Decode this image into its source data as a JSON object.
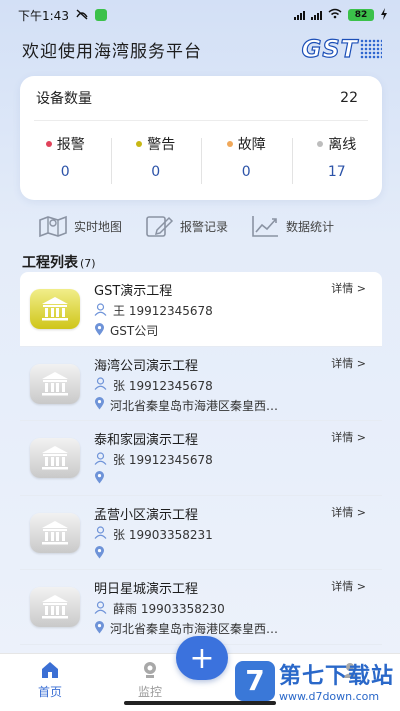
{
  "status_bar": {
    "time": "下午1:43",
    "right_text": "82"
  },
  "header": {
    "title": "欢迎使用海湾服务平台",
    "logo": "GST"
  },
  "device_card": {
    "label": "设备数量",
    "count": "22",
    "stats": [
      {
        "label": "报警",
        "value": "0",
        "color": "#e0425a"
      },
      {
        "label": "警告",
        "value": "0",
        "color": "#c7b714"
      },
      {
        "label": "故障",
        "value": "0",
        "color": "#f0a85a"
      },
      {
        "label": "离线",
        "value": "17",
        "color": "#bdbdbd"
      }
    ]
  },
  "quick_links": [
    {
      "label": "实时地图",
      "icon": "map-icon"
    },
    {
      "label": "报警记录",
      "icon": "edit-icon"
    },
    {
      "label": "数据统计",
      "icon": "chart-icon"
    }
  ],
  "project_list": {
    "title": "工程列表",
    "count": "(7)",
    "detail_label": "详情 >",
    "items": [
      {
        "name": "GST演示工程",
        "person": "王 19912345678",
        "location": "GST公司",
        "online": true
      },
      {
        "name": "海湾公司演示工程",
        "person": "张 19912345678",
        "location": "河北省秦皇岛市海港区秦皇西…",
        "online": false
      },
      {
        "name": "泰和家园演示工程",
        "person": "张 19912345678",
        "location": "",
        "online": false
      },
      {
        "name": "孟营小区演示工程",
        "person": "张 19903358231",
        "location": "",
        "online": false
      },
      {
        "name": "明日星城演示工程",
        "person": "薛雨 19903358230",
        "location": "河北省秦皇岛市海港区秦皇西…",
        "online": false
      }
    ]
  },
  "bottom_nav": {
    "items": [
      {
        "label": "首页",
        "active": true
      },
      {
        "label": "监控",
        "active": false
      },
      {
        "label": "",
        "active": false
      },
      {
        "label": "",
        "active": false
      }
    ],
    "fab": "+"
  },
  "watermark": {
    "badge": "7",
    "main": "第七下载站",
    "sub": "www.d7down.com"
  }
}
